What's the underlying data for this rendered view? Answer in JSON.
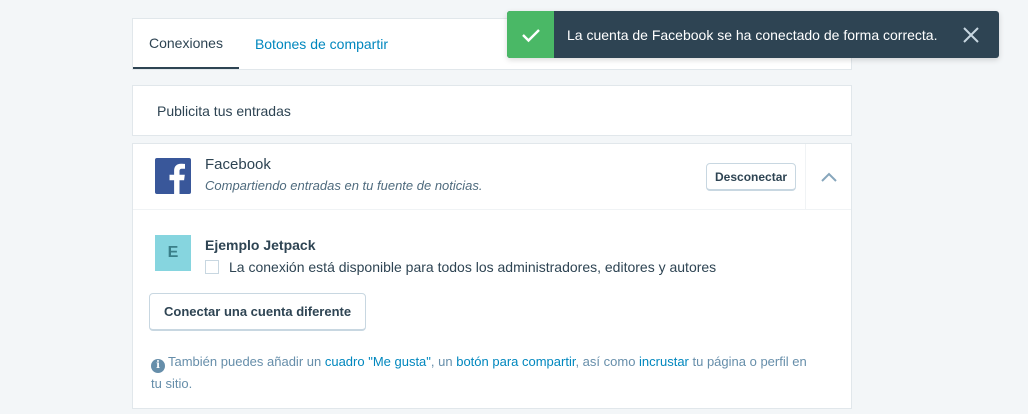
{
  "tabs": [
    {
      "label": "Conexiones"
    },
    {
      "label": "Botones de compartir"
    }
  ],
  "section": {
    "title": "Publicita tus entradas"
  },
  "facebook": {
    "name": "Facebook",
    "description": "Compartiendo entradas en tu fuente de noticias.",
    "disconnect_label": "Desconectar",
    "brand_color": "#39579a",
    "account": {
      "avatar_letter": "E",
      "name": "Ejemplo Jetpack",
      "checkbox_label": "La conexión está disponible para todos los administradores, editores y autores"
    },
    "connect_other_label": "Conectar una cuenta diferente"
  },
  "info": {
    "icon": "i",
    "t1": "También puedes añadir un ",
    "link_like": "cuadro \"Me gusta\"",
    "t2": ", un ",
    "link_share": "botón para compartir",
    "t3": ", así como ",
    "link_embed": "incrustar",
    "t4": " tu página o perfil en tu sitio."
  },
  "notice": {
    "text": "La cuenta de Facebook se ha conectado de forma correcta.",
    "success_color": "#4ab866"
  }
}
